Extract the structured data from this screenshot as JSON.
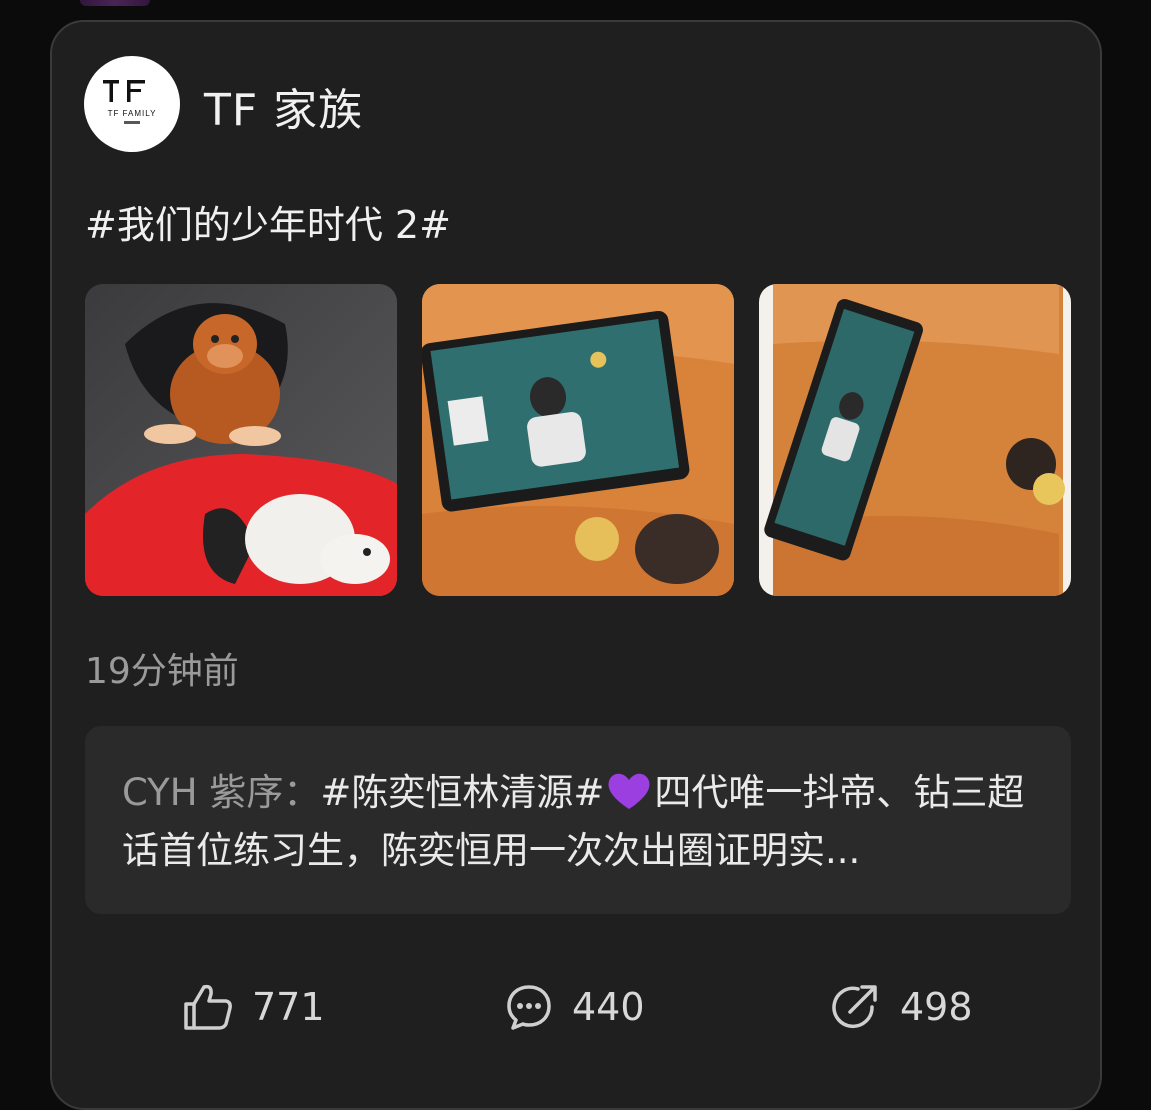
{
  "post": {
    "account_name": "TF 家族",
    "avatar_logo_text": "TF FAMILY",
    "topic": "#我们的少年时代 2#",
    "time": "19分钟前",
    "images": [
      "photo-1",
      "photo-2",
      "photo-3"
    ]
  },
  "repost": {
    "author": "CYH 紫序：",
    "text_part1": "#陈奕恒林清源#",
    "emoji": "purple-heart",
    "text_part2": "四代唯一抖帝、钻三超话首位练习生，陈奕恒用一次次出圈证明实..."
  },
  "actions": {
    "likes": "771",
    "comments": "440",
    "shares": "498"
  },
  "colors": {
    "card_bg": "#1f1f20",
    "repost_bg": "#2a2a2b",
    "muted_text": "#9a9a9a",
    "heart": "#9b3fe0"
  },
  "icons": [
    "thumbs-up-icon",
    "comment-icon",
    "share-icon"
  ]
}
